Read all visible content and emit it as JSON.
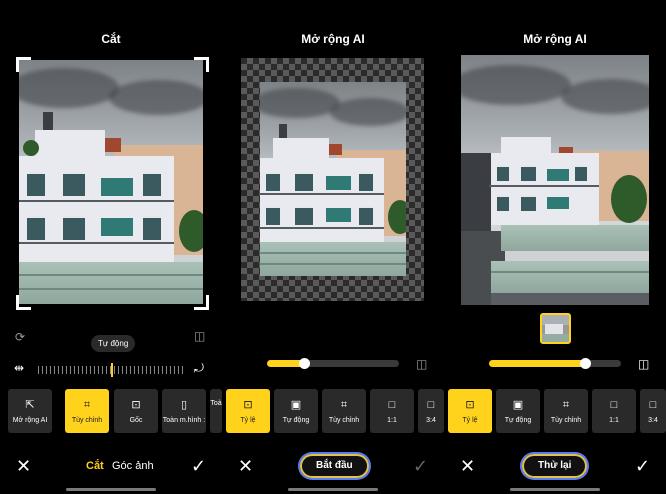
{
  "panel1": {
    "title": "Cắt",
    "tooltip": "Tự động",
    "tools": [
      {
        "label": "Mở rộng AI",
        "icon": "⇱"
      },
      {
        "label": "Tùy chỉnh",
        "icon": "⌗"
      },
      {
        "label": "Gốc",
        "icon": "⊡"
      },
      {
        "label": "Toàn m.hình :",
        "icon": "▯"
      },
      {
        "label": "Toà",
        "icon": ""
      }
    ],
    "tabs": {
      "active": "Cắt",
      "other": "Góc ảnh"
    }
  },
  "panel2": {
    "title": "Mở rộng AI",
    "slider_value": 0.28,
    "tools": [
      {
        "label": "Tỷ lệ",
        "icon": "⊡"
      },
      {
        "label": "Tự động",
        "icon": "▣"
      },
      {
        "label": "Tùy chỉnh",
        "icon": "⌗"
      },
      {
        "label": "1:1",
        "icon": "□"
      },
      {
        "label": "3:4",
        "icon": "□"
      }
    ],
    "action": "Bắt đầu"
  },
  "panel3": {
    "title": "Mở rộng AI",
    "slider_value": 0.73,
    "tools": [
      {
        "label": "Tỷ lệ",
        "icon": "⊡"
      },
      {
        "label": "Tự động",
        "icon": "▣"
      },
      {
        "label": "Tùy chỉnh",
        "icon": "⌗"
      },
      {
        "label": "1:1",
        "icon": "□"
      },
      {
        "label": "3:4",
        "icon": "□"
      }
    ],
    "action": "Thử lại"
  },
  "icons": {
    "rotate": "rotate-icon",
    "compare": "compare-icon",
    "flip": "flip-icon",
    "aspect": "aspect-rotate-icon",
    "close": "close-icon",
    "confirm": "check-icon"
  },
  "colors": {
    "accent": "#ffd21c",
    "pill_border": "#5b7cf0"
  }
}
